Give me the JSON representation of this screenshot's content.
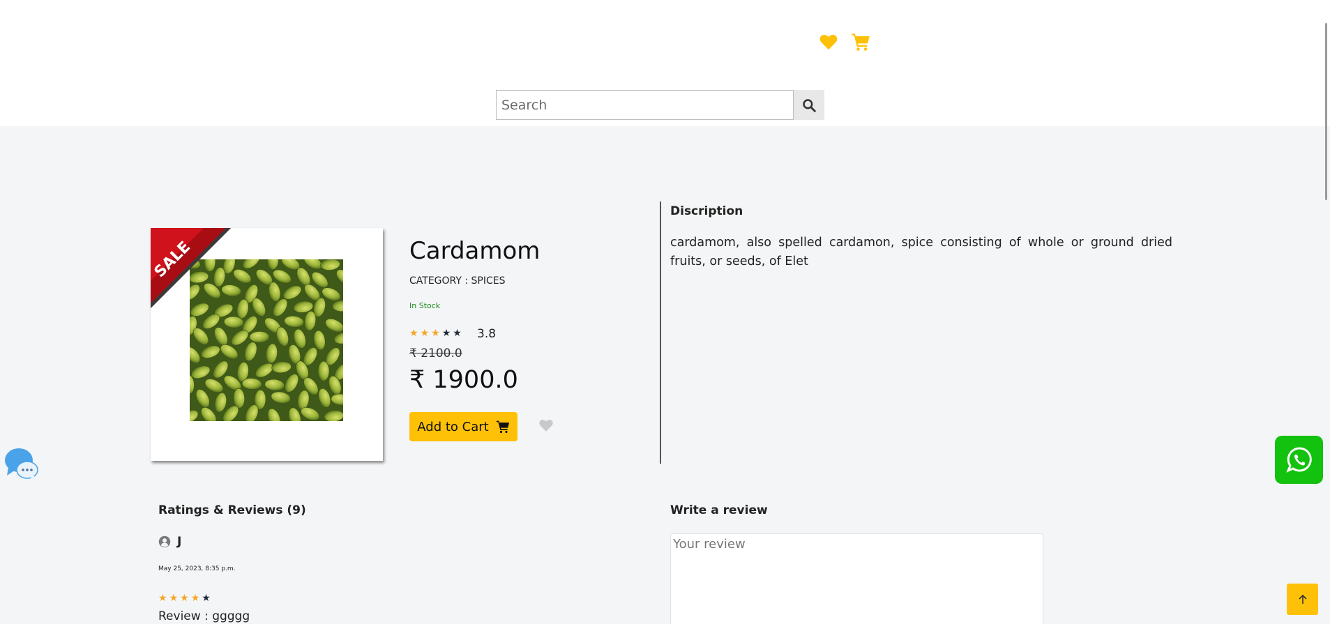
{
  "colors": {
    "accent": "#ffc107",
    "star_filled": "#f5a623",
    "star_empty": "#1f2a36",
    "in_stock": "#1b8a1b",
    "whatsapp": "#13c10f"
  },
  "header": {
    "wishlist_icon": "heart-icon",
    "cart_icon": "cart-icon"
  },
  "search": {
    "placeholder": "Search",
    "value": "",
    "button_icon": "search-icon"
  },
  "product": {
    "badge": "SALE",
    "title": "Cardamom",
    "category": "CATEGORY : SPICES",
    "stock": "In Stock",
    "rating": {
      "value": "3.8",
      "stars": 3,
      "max": 5
    },
    "old_price": "₹ 2100.0",
    "price": "₹ 1900.0",
    "add_to_cart_label": "Add to Cart"
  },
  "description": {
    "title": "Discription",
    "text": "cardamom, also spelled cardamon, spice consisting of whole or ground dried fruits, or seeds, of Elet"
  },
  "reviews": {
    "title": "Ratings & Reviews (9)",
    "items": [
      {
        "name": "J",
        "date": "May 25, 2023, 8:35 p.m.",
        "stars": 4,
        "max": 5,
        "text": "Review : ggggg"
      }
    ]
  },
  "write_review": {
    "title": "Write a review",
    "placeholder": "Your review",
    "value": ""
  }
}
